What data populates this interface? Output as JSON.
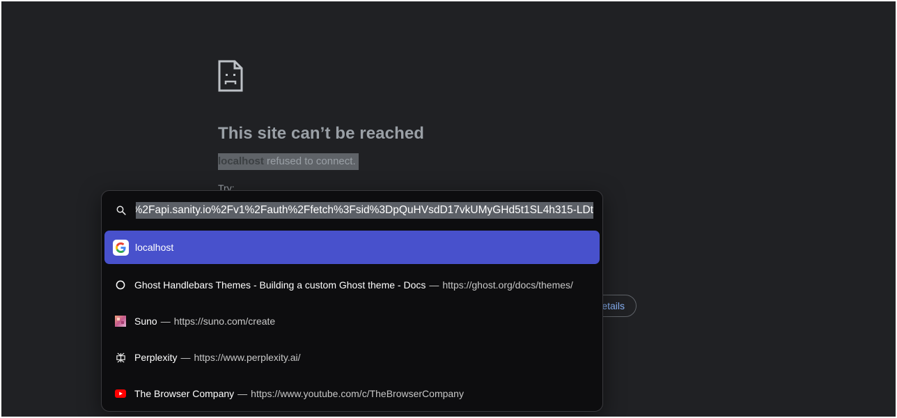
{
  "error_page": {
    "title": "This site can’t be reached",
    "host": "localhost",
    "message": " refused to connect.",
    "try_label": "Try:",
    "details_label": "etails"
  },
  "command_bar": {
    "query": "f%2Fapi.sanity.io%2Fv1%2Fauth%2Ffetch%3Fsid%3DpQuHVsdD17vkUMyGHd5t1SL4h315-LDt",
    "separator": "—",
    "results": [
      {
        "icon": "google-icon",
        "title": "localhost",
        "url": ""
      },
      {
        "icon": "globe-icon",
        "title": "Ghost Handlebars Themes - Building a custom Ghost theme - Docs",
        "url": "https://ghost.org/docs/themes/"
      },
      {
        "icon": "suno-icon",
        "title": "Suno",
        "url": "https://suno.com/create"
      },
      {
        "icon": "perplexity-icon",
        "title": "Perplexity",
        "url": "https://www.perplexity.ai/"
      },
      {
        "icon": "youtube-icon",
        "title": "The Browser Company",
        "url": "https://www.youtube.com/c/TheBrowserCompany"
      }
    ]
  },
  "colors": {
    "page_background": "#202124",
    "selected_row": "#4851cc",
    "link": "#8ab4f8"
  }
}
